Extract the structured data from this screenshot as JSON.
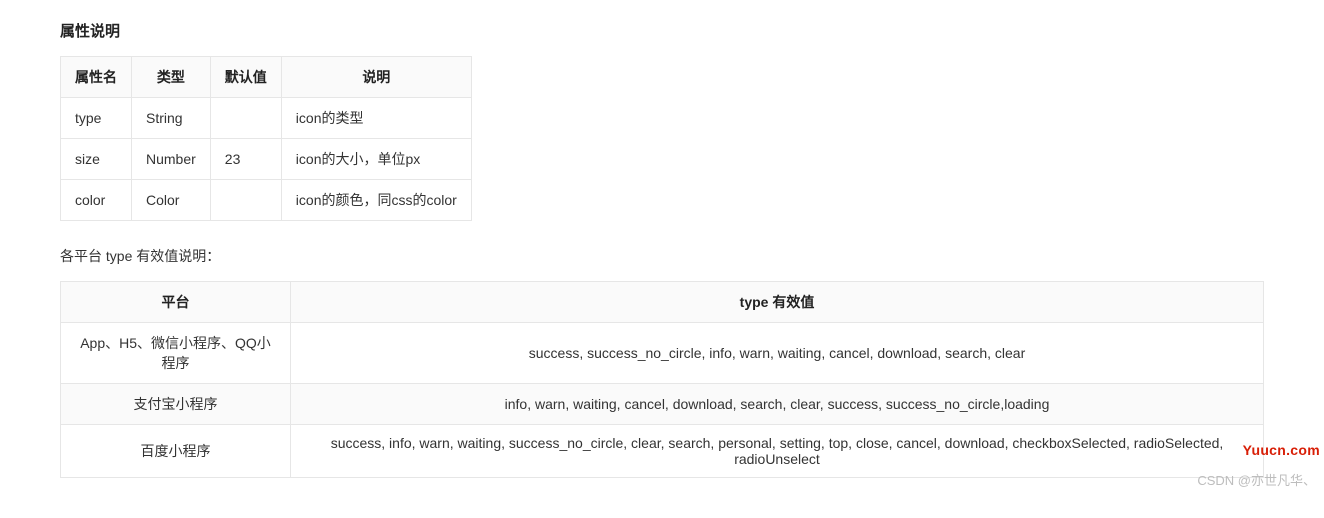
{
  "section_title": "属性说明",
  "attrs_table": {
    "headers": [
      "属性名",
      "类型",
      "默认值",
      "说明"
    ],
    "rows": [
      {
        "name": "type",
        "type": "String",
        "default": "",
        "desc": "icon的类型"
      },
      {
        "name": "size",
        "type": "Number",
        "default": "23",
        "desc": "icon的大小，单位px"
      },
      {
        "name": "color",
        "type": "Color",
        "default": "",
        "desc": "icon的颜色，同css的color"
      }
    ]
  },
  "type_note": "各平台 type 有效值说明：",
  "types_table": {
    "headers": [
      "平台",
      "type 有效值"
    ],
    "rows": [
      {
        "platform": "App、H5、微信小程序、QQ小程序",
        "values": "success, success_no_circle, info, warn, waiting, cancel, download, search, clear"
      },
      {
        "platform": "支付宝小程序",
        "values": "info, warn, waiting, cancel, download, search, clear, success, success_no_circle,loading"
      },
      {
        "platform": "百度小程序",
        "values": "success, info, warn, waiting, success_no_circle, clear, search, personal, setting, top, close, cancel, download, checkboxSelected, radioSelected, radioUnselect"
      }
    ]
  },
  "watermark_red": "Yuucn.com",
  "watermark_gray": "CSDN @亦世凡华、"
}
